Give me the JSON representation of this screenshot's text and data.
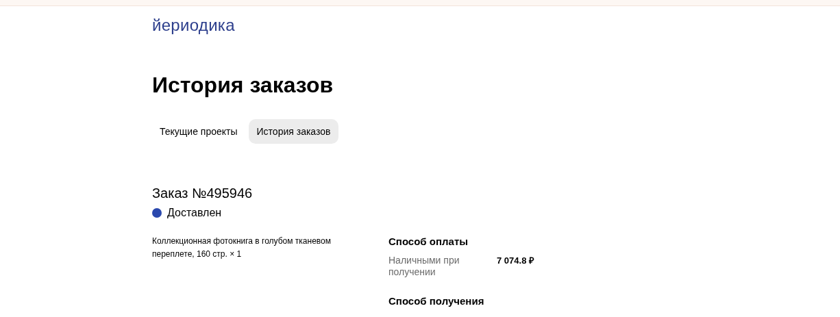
{
  "logo": "йериодика",
  "title": "История заказов",
  "tabs": [
    {
      "label": "Текущие проекты",
      "selected": false
    },
    {
      "label": "История заказов",
      "selected": true
    }
  ],
  "order": {
    "title": "Заказ №495946",
    "status": {
      "label": "Доставлен",
      "color": "#2a48ad"
    },
    "items": [
      "Коллекционная фотокнига в голубом тканевом переплете, 160 стр. × 1"
    ],
    "payment": {
      "heading": "Способ оплаты",
      "method": "Наличными при получении",
      "amount": "7 074.8 ₽"
    },
    "delivery": {
      "heading": "Способ получения"
    }
  }
}
